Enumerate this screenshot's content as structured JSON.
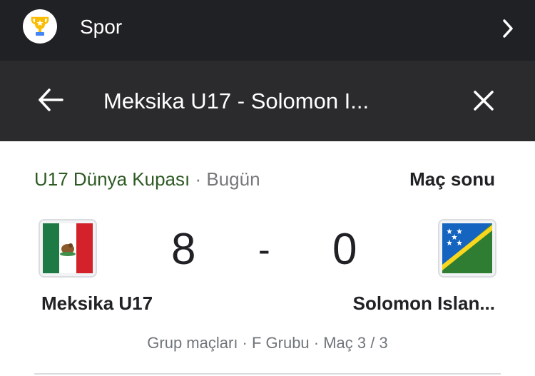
{
  "header": {
    "app_title": "Spor"
  },
  "search": {
    "query": "Meksika U17 - Solomon I..."
  },
  "match": {
    "league": "U17 Dünya Kupası",
    "separator": " · ",
    "when": "Bugün",
    "status": "Maç sonu",
    "home": {
      "name": "Meksika U17",
      "score": "8",
      "flag": "mexico-flag-icon"
    },
    "dash": "-",
    "away": {
      "name": "Solomon Islan...",
      "score": "0",
      "flag": "solomon-islands-flag-icon"
    },
    "details": "Grup maçları · F Grubu · Maç 3 / 3"
  },
  "colors": {
    "topbar": "#202124",
    "searchbar": "#2b2b2d",
    "league_text": "#2e5a24",
    "muted_text": "#70757a"
  }
}
